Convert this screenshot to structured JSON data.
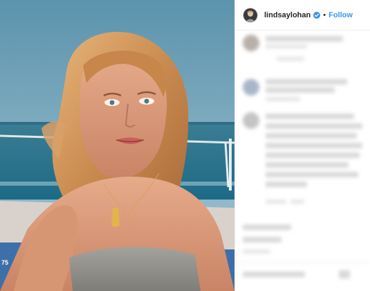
{
  "post": {
    "username": "lindsaylohan",
    "verified_icon": "verified-badge-icon",
    "separator": "•",
    "follow_label": "Follow"
  },
  "photo": {
    "icon": "selfie-photo"
  },
  "comments": {
    "state": "blurred"
  },
  "colors": {
    "follow": "#3897f0",
    "verified": "#3897f0",
    "username": "#262626"
  }
}
